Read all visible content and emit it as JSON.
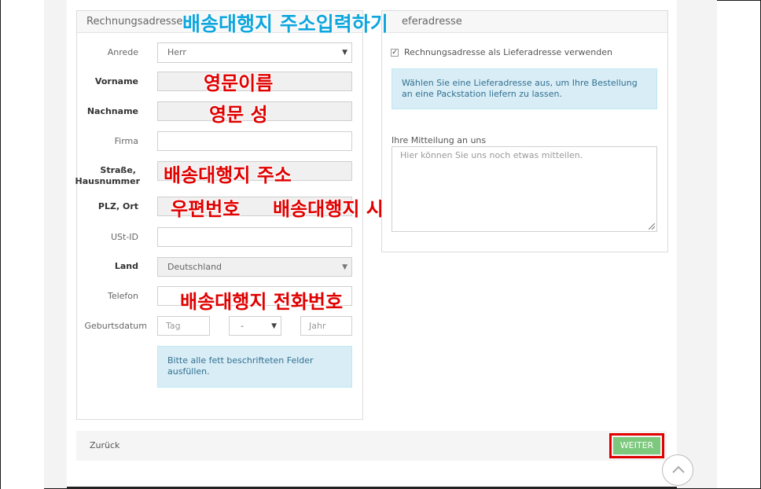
{
  "billing": {
    "header": "Rechnungsadresse",
    "fields": {
      "anrede": {
        "label": "Anrede",
        "value": "Herr"
      },
      "vorname": {
        "label": "Vorname"
      },
      "nachname": {
        "label": "Nachname"
      },
      "firma": {
        "label": "Firma"
      },
      "strasse": {
        "label_line1": "Straße,",
        "label_line2": "Hausnummer"
      },
      "plz": {
        "label": "PLZ, Ort"
      },
      "ustid": {
        "label": "USt-ID"
      },
      "land": {
        "label": "Land",
        "value": "Deutschland"
      },
      "telefon": {
        "label": "Telefon"
      },
      "geburtsdatum": {
        "label": "Geburtsdatum",
        "day_placeholder": "Tag",
        "month_value": "-",
        "year_placeholder": "Jahr"
      }
    },
    "required_note": "Bitte alle fett beschrifteten Felder ausfüllen."
  },
  "shipping": {
    "header": "Lieferadresse",
    "header_visible": "eferadresse",
    "use_billing_label": "Rechnungsadresse als Lieferadresse verwenden",
    "use_billing_checked": true,
    "info": "Wählen Sie eine Lieferadresse aus, um Ihre Bestellung an eine Packstation liefern zu lassen.",
    "message_label": "Ihre Mitteilung an uns",
    "message_placeholder": "Hier können Sie uns noch etwas mitteilen."
  },
  "actions": {
    "back": "Zurück",
    "next": "WEITER"
  },
  "annotations": {
    "title": "배송대행지 주소입력하기",
    "first_name": "영문이름",
    "last_name": "영문 성",
    "street": "배송대행지 주소",
    "zip": "우편번호",
    "city": "배송대행지 시",
    "phone": "배송대행지 전화번호"
  },
  "colors": {
    "annotation_red": "#e00000",
    "annotation_blue": "#0fa6dd",
    "button_green": "#7cc87d",
    "info_bg": "#d9edf7"
  }
}
